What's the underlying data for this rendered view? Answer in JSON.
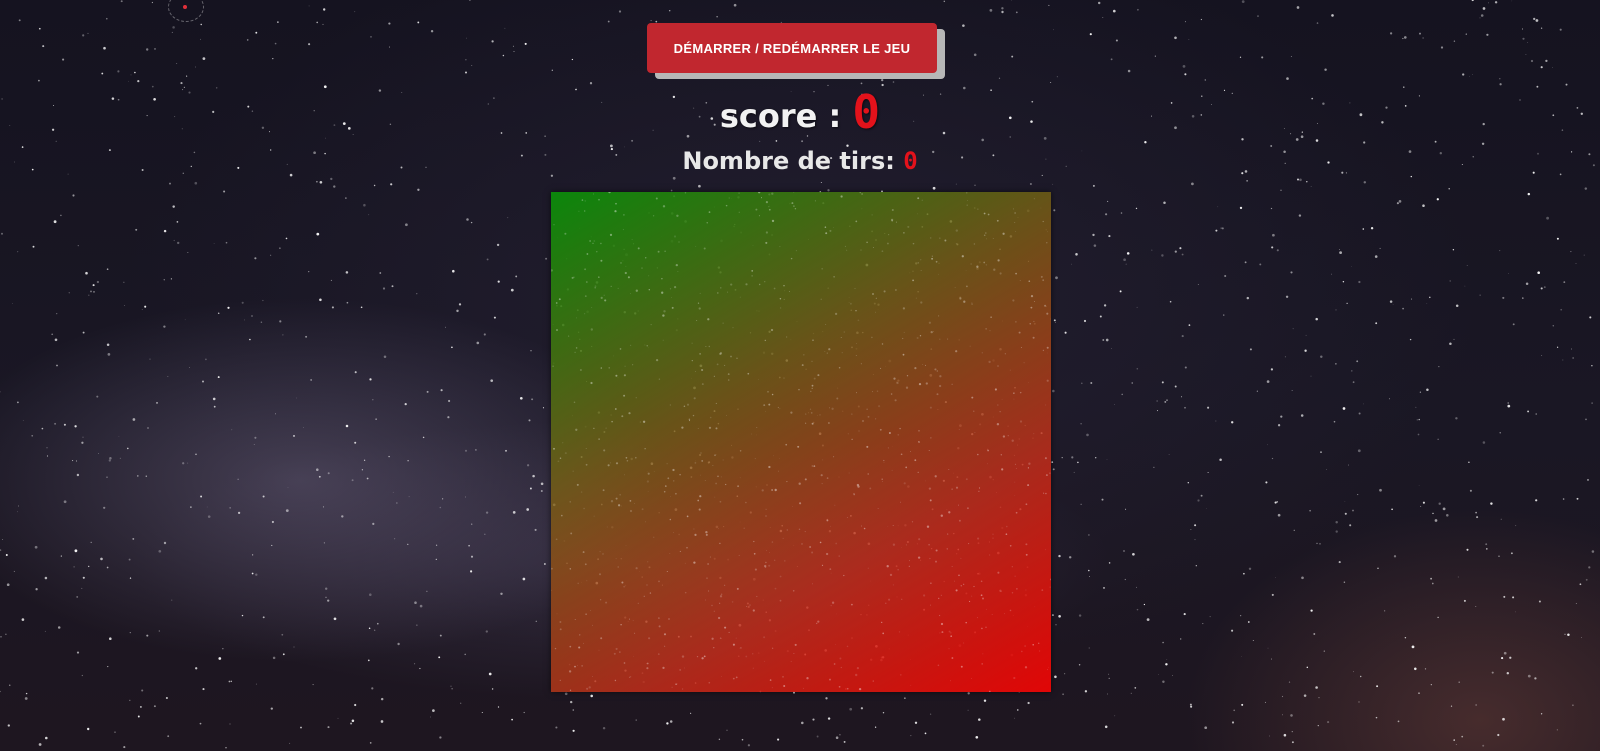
{
  "controls": {
    "start_button_label": "DÉMARRER / REDÉMARRER LE JEU"
  },
  "score": {
    "label": "score : ",
    "value": "0"
  },
  "shots": {
    "label": "Nombre de tirs: ",
    "value": "0"
  },
  "colors": {
    "accent_red": "#c1272f",
    "value_red": "#e3121b",
    "board_gradient_start": "#0a8c0a",
    "board_gradient_end": "#eb0505"
  }
}
